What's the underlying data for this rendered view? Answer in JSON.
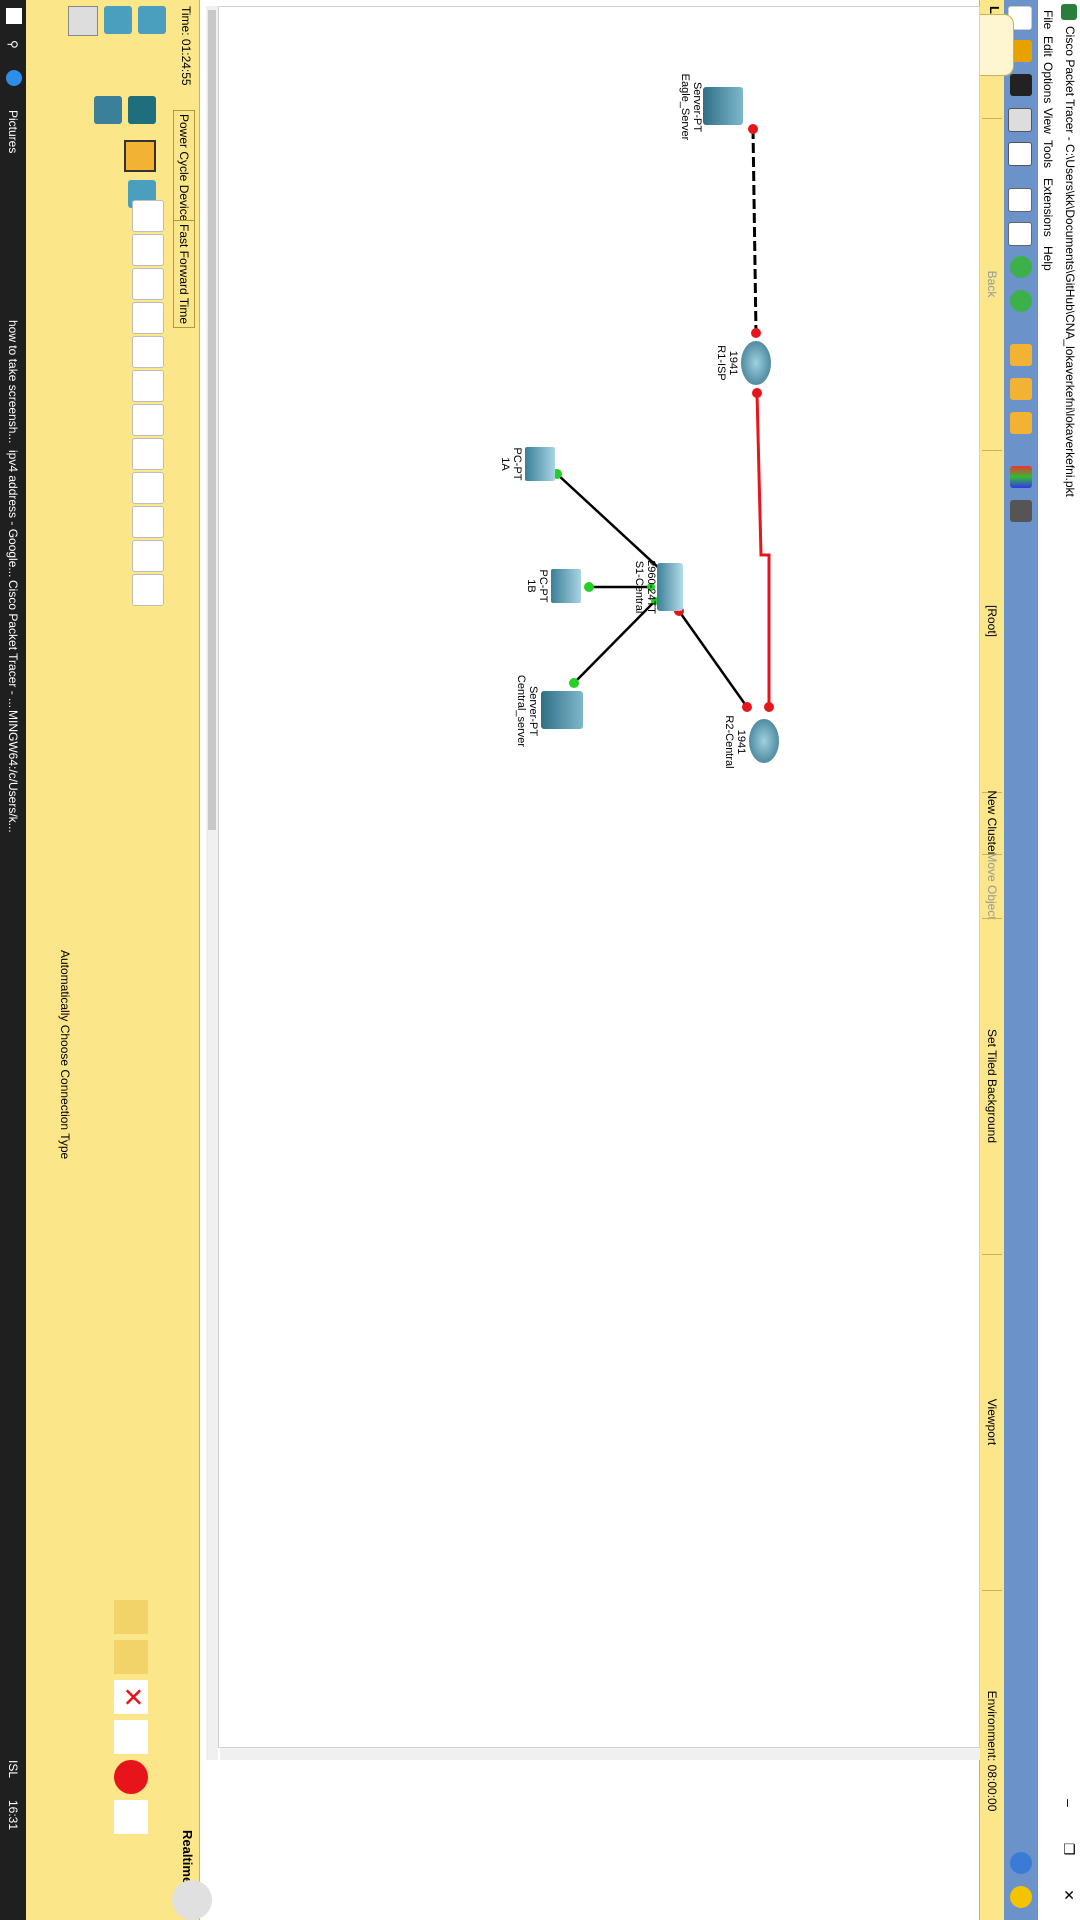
{
  "window": {
    "title": "Cisco Packet Tracer - C:\\Users\\kk\\Documents\\GitHub\\CNA_lokaverkefni\\lokaverkefni.pkt"
  },
  "menu": [
    "File",
    "Edit",
    "Options",
    "View",
    "Tools",
    "Extensions",
    "Help"
  ],
  "logical_bar": {
    "mode": "Logical",
    "back": "Back",
    "root": "[Root]",
    "new_cluster": "New Cluster",
    "move_object": "Move Object",
    "set_tiled_background": "Set Tiled Background",
    "viewport": "Viewport",
    "environment": "Environment: 08:00:00"
  },
  "devices": {
    "eagle_server": {
      "type": "Server-PT",
      "name": "Eagle_Server"
    },
    "r1": {
      "type": "1941",
      "name": "R1-ISP"
    },
    "pc1a": {
      "type": "PC-PT",
      "name": "1A"
    },
    "pc1b": {
      "type": "PC-PT",
      "name": "1B"
    },
    "switch": {
      "type": "2960-24TT",
      "name": "S1-Central"
    },
    "central_server": {
      "type": "Server-PT",
      "name": "Central_server"
    },
    "r2": {
      "type": "1941",
      "name": "R2-Central"
    }
  },
  "bottom": {
    "time": "Time: 01:24:55",
    "power_cycle": "Power Cycle Devices",
    "fast_forward": "Fast Forward Time",
    "realtime": "Realtime",
    "connection_hint": "Automatically Choose Connection Type"
  },
  "taskbar": {
    "pictures": "Pictures",
    "how_to": "how to take screensh...",
    "ipv4": "ipv4 address - Google...",
    "packet_tracer": "Cisco Packet Tracer - ...",
    "mingw": "MINGW64:/c/Users/k...",
    "lang": "ISL",
    "clock": "16:31"
  },
  "colors": {
    "accent_yellow": "#fbe68a",
    "toolbar_blue": "#6b93c9",
    "serial_red": "#e8141c",
    "link_green": "#23d023"
  }
}
